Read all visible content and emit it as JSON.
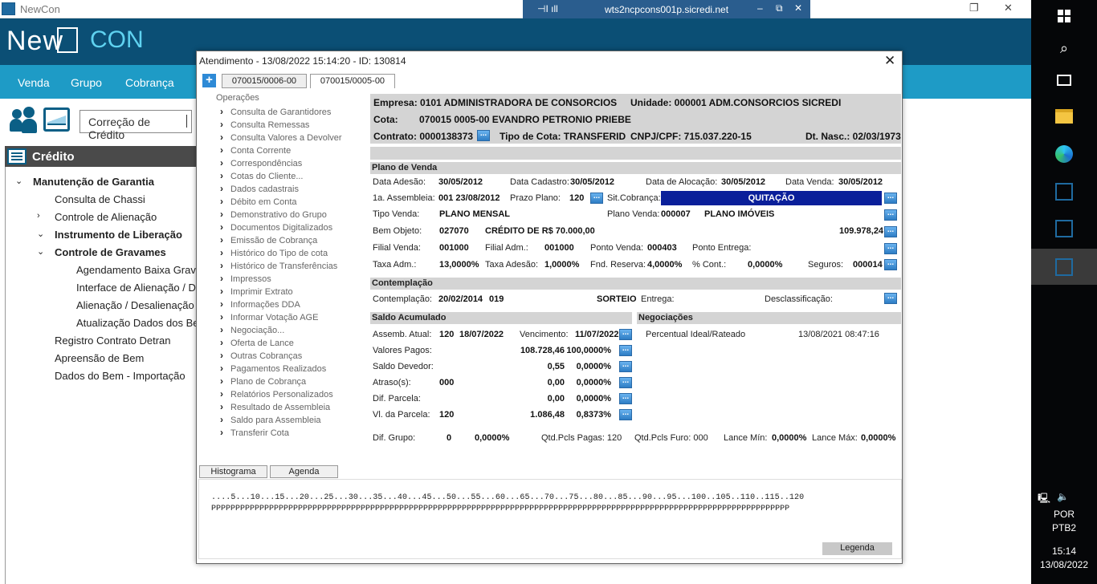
{
  "app": {
    "title": "NewCon",
    "logo_left": "New",
    "logo_right": "CON",
    "remote_host": "wts2ncpcons001p.sicredi.net"
  },
  "menu": [
    "Venda",
    "Grupo",
    "Cobrança"
  ],
  "search_box": "Correção de Crédito",
  "credito": {
    "title": "Crédito",
    "tree": [
      {
        "label": "Manutenção de Garantia",
        "level": 0,
        "bold": true,
        "arrow": "v"
      },
      {
        "label": "Consulta de Chassi",
        "level": 1
      },
      {
        "label": "Controle de Alienação",
        "level": 1,
        "arrow": ">"
      },
      {
        "label": "Instrumento de Liberação",
        "level": 1,
        "bold": true,
        "arrow": "v"
      },
      {
        "label": "Controle de Gravames",
        "level": 1,
        "bold": true,
        "arrow": "v"
      },
      {
        "label": "Agendamento Baixa Gravames",
        "level": 2
      },
      {
        "label": "Interface de Alienação / Des",
        "level": 2
      },
      {
        "label": "Alienação / Desalienação /",
        "level": 2
      },
      {
        "label": "Atualização Dados dos Bem",
        "level": 2
      },
      {
        "label": "Registro Contrato Detran",
        "level": 1
      },
      {
        "label": "Apreensão de Bem",
        "level": 1
      },
      {
        "label": "Dados do Bem - Importação",
        "level": 1
      }
    ]
  },
  "dialog": {
    "title": "Atendimento - 13/08/2022  15:14:20 - ID: 130814",
    "tabs": [
      "070015/0006-00",
      "070015/0005-00"
    ],
    "operacoes_label": "Operações",
    "operacoes": [
      "Consulta de Garantidores",
      "Consulta Remessas",
      "Consulta Valores a Devolver",
      "Conta Corrente",
      "Correspondências",
      "Cotas do Cliente...",
      "Dados cadastrais",
      "Débito em Conta",
      "Demonstrativo do Grupo",
      "Documentos Digitalizados",
      "Emissão de Cobrança",
      "Histórico do Tipo de cota",
      "Histórico de Transferências",
      "Impressos",
      "Imprimir Extrato",
      "Informações DDA",
      "Informar Votação AGE",
      "Negociação...",
      "Oferta de Lance",
      "Outras Cobranças",
      "Pagamentos Realizados",
      "Plano de Cobrança",
      "Relatórios Personalizados",
      "Resultado de Assembleia",
      "Saldo para Assembleia",
      "Transferir Cota"
    ],
    "header": {
      "empresa": "Empresa: 0101 ADMINISTRADORA DE CONSORCIOS",
      "unidade": "Unidade: 000001 ADM.CONSORCIOS SICREDI",
      "cota_label": "Cota:",
      "cota": "070015  0005-00  EVANDRO PETRONIO PRIEBE",
      "contrato": "Contrato: 0000138373",
      "tipo_cota": "Tipo de Cota: TRANSFERID",
      "cnpj": "CNPJ/CPF: 715.037.220-15",
      "dt_nasc": "Dt. Nasc.: 02/03/1973"
    },
    "plano": {
      "title": "Plano de Venda",
      "data_adesao_l": "Data Adesão:",
      "data_adesao": "30/05/2012",
      "data_cadastro_l": "Data Cadastro:",
      "data_cadastro": "30/05/2012",
      "data_alocacao_l": "Data de Alocação:",
      "data_alocacao": "30/05/2012",
      "data_venda_l": "Data Venda:",
      "data_venda": "30/05/2012",
      "assembleia_l": "1a. Assembleia:",
      "assembleia": "001  23/08/2012",
      "prazo_l": "Prazo Plano:",
      "prazo": "120",
      "sitcob_l": "Sit.Cobrança:",
      "sitcob": "QUITAÇÃO",
      "tipo_venda_l": "Tipo Venda:",
      "tipo_venda": "PLANO MENSAL",
      "plano_venda_l": "Plano Venda:",
      "plano_venda": "000007",
      "plano_venda_desc": "PLANO IMÓVEIS",
      "bem_l": "Bem Objeto:",
      "bem": "027070",
      "bem_desc": "CRÉDITO DE R$ 70.000,00",
      "bem_valor": "109.978,24",
      "filial_venda_l": "Filial Venda:",
      "filial_venda": "001000",
      "filial_adm_l": "Filial Adm.:",
      "filial_adm": "001000",
      "ponto_venda_l": "Ponto Venda:",
      "ponto_venda": "000403",
      "ponto_entrega_l": "Ponto Entrega:",
      "taxa_adm_l": "Taxa Adm.:",
      "taxa_adm": "13,0000%",
      "taxa_adesao_l": "Taxa Adesão:",
      "taxa_adesao": "1,0000%",
      "fnd_l": "Fnd. Reserva:",
      "fnd": "4,0000%",
      "cont_l": "% Cont.:",
      "cont": "0,0000%",
      "seguros_l": "Seguros:",
      "seguros": "000014"
    },
    "contemplacao": {
      "title": "Contemplação",
      "label": "Contemplação:",
      "data": "20/02/2014",
      "num": "019",
      "tipo": "SORTEIO",
      "entrega_l": "Entrega:",
      "descl_l": "Desclassificação:"
    },
    "saldo": {
      "title": "Saldo Acumulado",
      "assemb_l": "Assemb. Atual:",
      "assemb": "120",
      "assemb_data": "18/07/2022",
      "venc_l": "Vencimento:",
      "venc": "11/07/2022",
      "rows": [
        {
          "label": "Valores Pagos:",
          "a": "",
          "b": "108.728,46",
          "c": "100,0000%"
        },
        {
          "label": "Saldo Devedor:",
          "a": "",
          "b": "0,55",
          "c": "0,0000%"
        },
        {
          "label": "Atraso(s):",
          "a": "000",
          "b": "0,00",
          "c": "0,0000%"
        },
        {
          "label": "Dif. Parcela:",
          "a": "",
          "b": "0,00",
          "c": "0,0000%"
        },
        {
          "label": "Vl. da Parcela:",
          "a": "120",
          "b": "1.086,48",
          "c": "0,8373%"
        }
      ]
    },
    "negociacoes": {
      "title": "Negociações",
      "item": "Percentual Ideal/Rateado",
      "data": "13/08/2021 08:47:16"
    },
    "footer": {
      "dif_l": "Dif. Grupo:",
      "dif_a": "0",
      "dif_b": "0,0000%",
      "pagas": "Qtd.Pcls Pagas: 120",
      "furo": "Qtd.Pcls Furo: 000",
      "lmin_l": "Lance Mín:",
      "lmin": "0,0000%",
      "lmax_l": "Lance Máx:",
      "lmax": "0,0000%"
    },
    "bottom_tabs": [
      "Histograma",
      "Agenda"
    ],
    "histo_scale": "....5...10...15...20...25...30...35...40...45...50...55...60...65...70...75...80...85...90...95...100..105..110..115..120",
    "histo_row": "PPPPPPPPPPPPPPPPPPPPPPPPPPPPPPPPPPPPPPPPPPPPPPPPPPPPPPPPPPPPPPPPPPPPPPPPPPPPPPPPPPPPPPPPPPPPPPPPPPPPPPPPPPPPPPPPPPPPPPPP",
    "legenda": "Legenda"
  },
  "taskbar": {
    "lang1": "POR",
    "lang2": "PTB2",
    "time": "15:14",
    "date": "13/08/2022"
  },
  "colors": {
    "header": "#0b4f75",
    "menu": "#1e9bc6",
    "quitacao": "#0a1f9a"
  }
}
